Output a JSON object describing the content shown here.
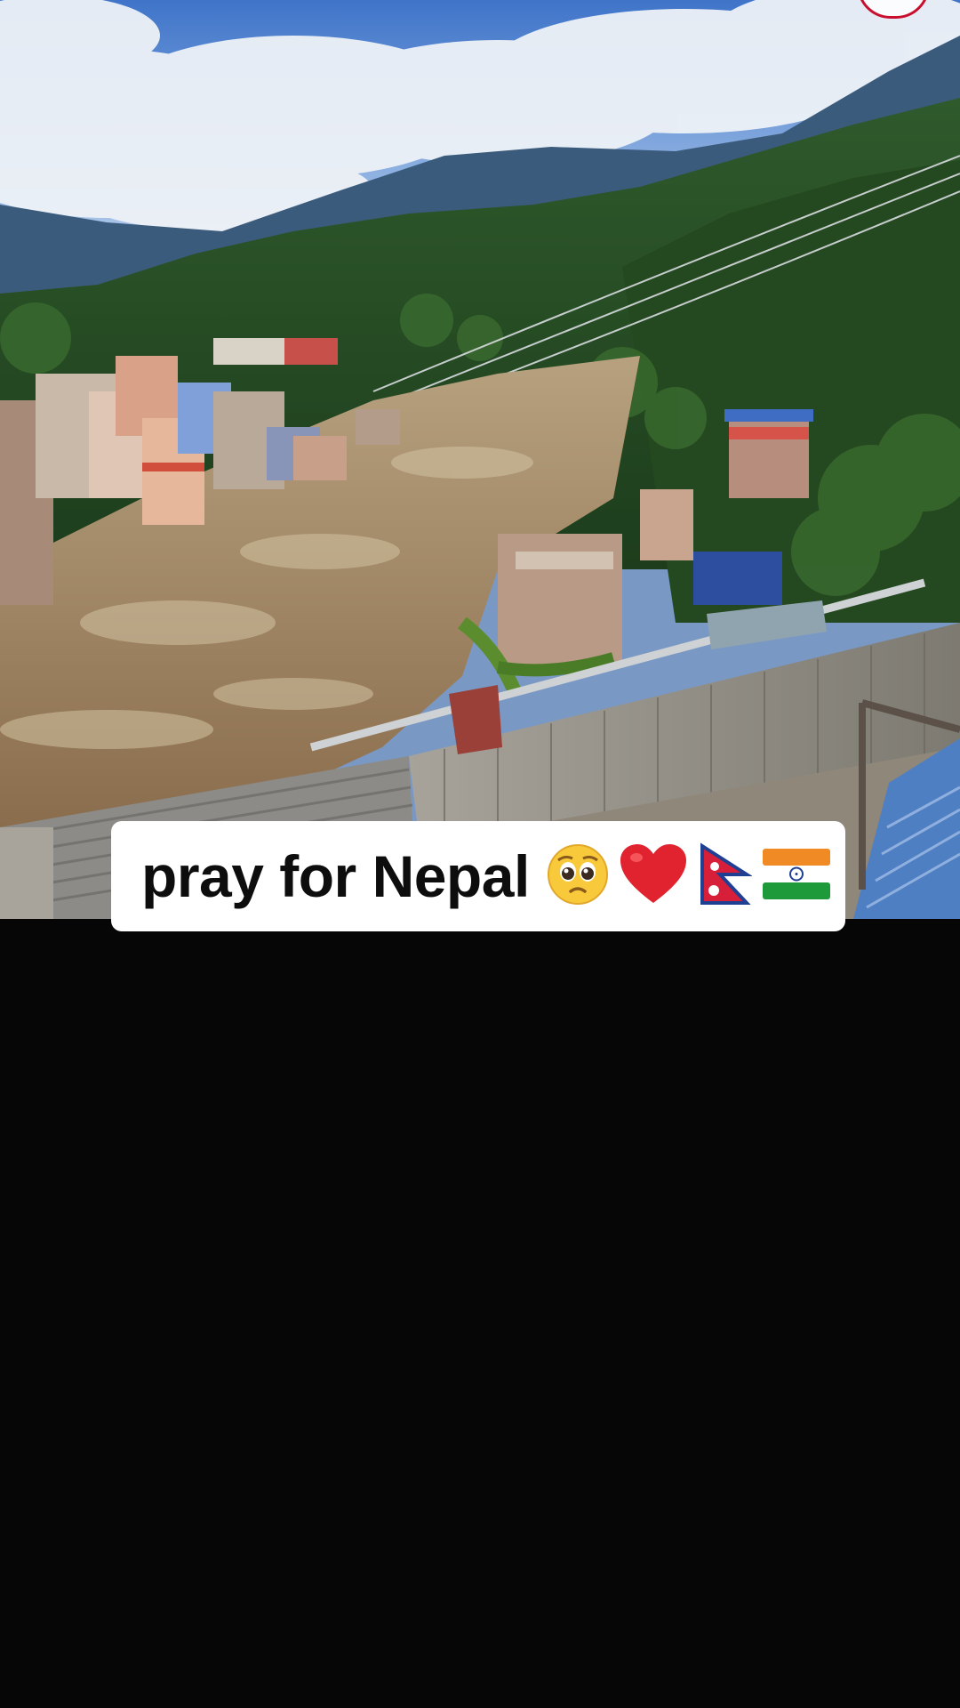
{
  "post": {
    "caption": "pray for Nepal",
    "emojis": [
      "pleading-face",
      "red-heart",
      "nepal-flag",
      "india-flag"
    ]
  },
  "colors": {
    "caption_bg": "#ffffff",
    "caption_text": "#0d0d0d",
    "screen_bg": "#060607",
    "floodwater": "#9a7f5e"
  }
}
